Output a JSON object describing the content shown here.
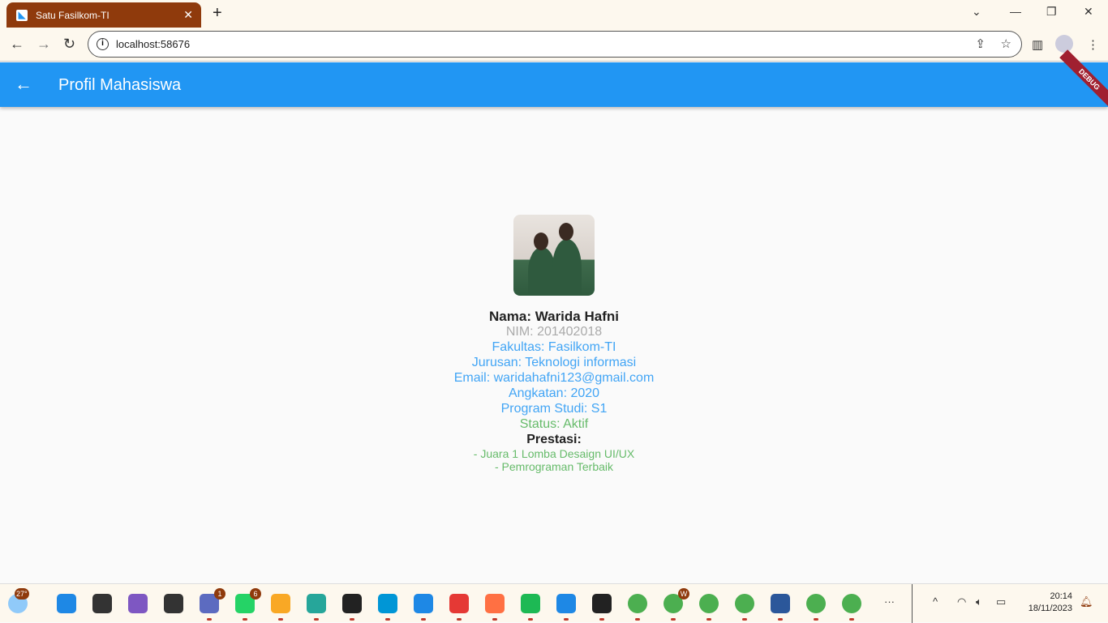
{
  "browser": {
    "tab_title": "Satu Fasilkom-TI",
    "url": "localhost:58676"
  },
  "app": {
    "title": "Profil Mahasiswa",
    "debug_banner": "DEBUG"
  },
  "profile": {
    "nama": "Nama: Warida Hafni",
    "nim": "NIM: 201402018",
    "fakultas": "Fakultas: Fasilkom-TI",
    "jurusan": "Jurusan: Teknologi informasi",
    "email": "Email: waridahafni123@gmail.com",
    "angkatan": "Angkatan: 2020",
    "prodi": "Program Studi: S1",
    "status": "Status: Aktif",
    "prestasi_label": "Prestasi:",
    "prestasi": [
      "- Juara 1 Lomba Desaign UI/UX",
      "- Pemrograman Terbaik"
    ]
  },
  "taskbar": {
    "weather": "27°",
    "apps": [
      {
        "name": "start",
        "color": "#1e88e5"
      },
      {
        "name": "search",
        "color": "#333333"
      },
      {
        "name": "copilot",
        "color": "#7e57c2"
      },
      {
        "name": "task-view",
        "color": "#333333"
      },
      {
        "name": "teams-chat",
        "color": "#5c6bc0",
        "badge": "1"
      },
      {
        "name": "whatsapp",
        "color": "#25d366",
        "badge": "6"
      },
      {
        "name": "file-explorer",
        "color": "#f9a825"
      },
      {
        "name": "edge",
        "color": "#26a69a"
      },
      {
        "name": "store",
        "color": "#222222"
      },
      {
        "name": "myhp",
        "color": "#0096d6"
      },
      {
        "name": "help",
        "color": "#1e88e5"
      },
      {
        "name": "app-owl",
        "color": "#e53935"
      },
      {
        "name": "firefox",
        "color": "#ff7043"
      },
      {
        "name": "spotify",
        "color": "#1db954"
      },
      {
        "name": "vscode",
        "color": "#1e88e5"
      },
      {
        "name": "figma",
        "color": "#222222"
      },
      {
        "name": "chrome",
        "color": "#4caf50"
      },
      {
        "name": "chrome",
        "color": "#4caf50",
        "badge": "W"
      },
      {
        "name": "chrome",
        "color": "#4caf50"
      },
      {
        "name": "chrome",
        "color": "#4caf50"
      },
      {
        "name": "word",
        "color": "#2b579a"
      },
      {
        "name": "chrome",
        "color": "#4caf50"
      },
      {
        "name": "chrome",
        "color": "#4caf50"
      }
    ],
    "time": "20:14",
    "date": "18/11/2023"
  }
}
